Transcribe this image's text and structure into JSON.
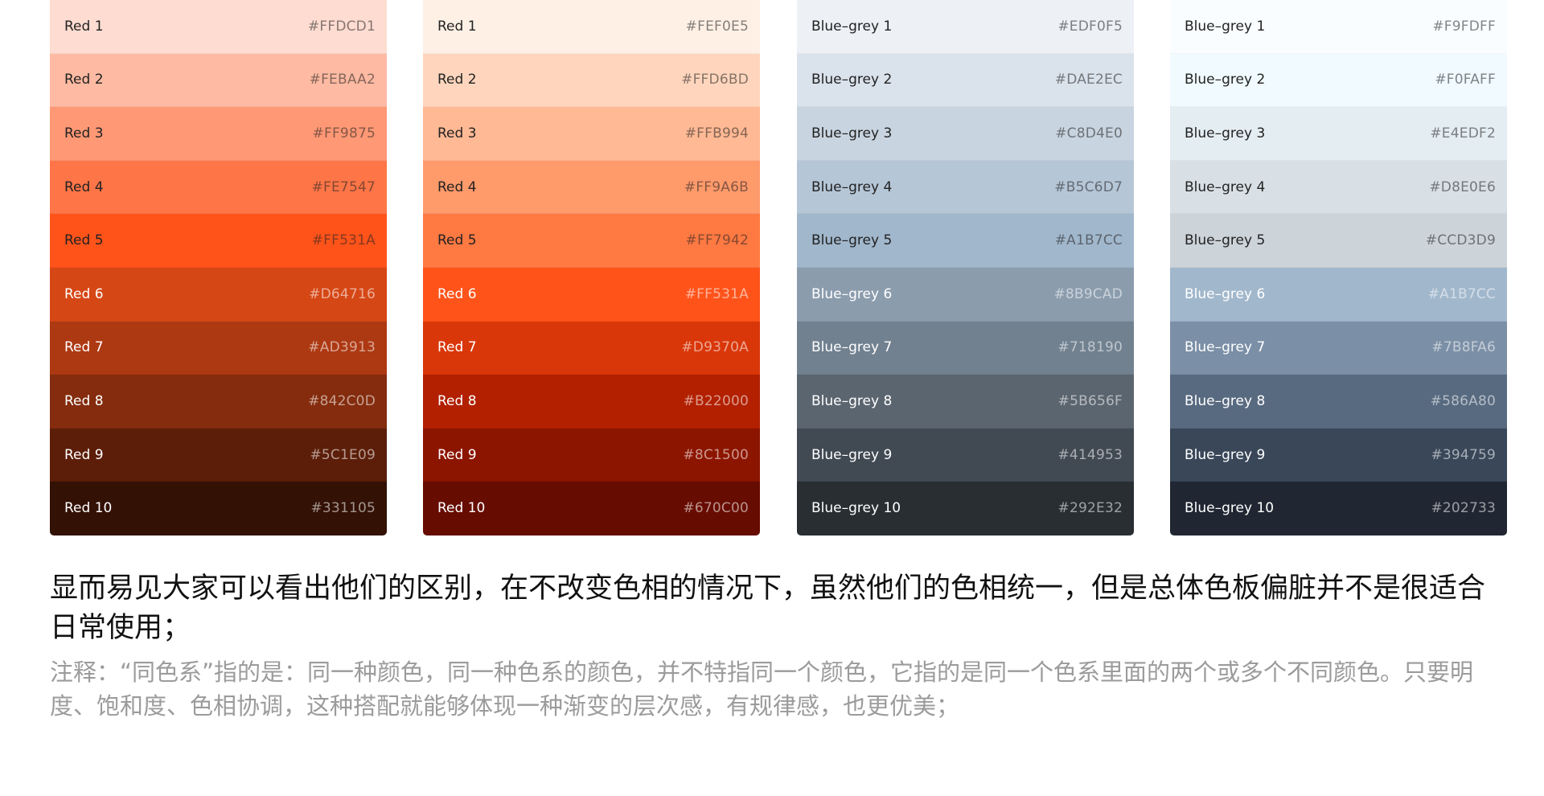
{
  "palettes": [
    {
      "swatches": [
        {
          "label": "Red 1",
          "hex": "#FFDCD1",
          "text": "#222222"
        },
        {
          "label": "Red 2",
          "hex": "#FEBAA2",
          "text": "#222222"
        },
        {
          "label": "Red 3",
          "hex": "#FF9875",
          "text": "#222222"
        },
        {
          "label": "Red 4",
          "hex": "#FE7547",
          "text": "#222222"
        },
        {
          "label": "Red 5",
          "hex": "#FF531A",
          "text": "#222222"
        },
        {
          "label": "Red 6",
          "hex": "#D64716",
          "text": "#ffffff"
        },
        {
          "label": "Red 7",
          "hex": "#AD3913",
          "text": "#ffffff"
        },
        {
          "label": "Red 8",
          "hex": "#842C0D",
          "text": "#ffffff"
        },
        {
          "label": "Red 9",
          "hex": "#5C1E09",
          "text": "#ffffff"
        },
        {
          "label": "Red 10",
          "hex": "#331105",
          "text": "#ffffff"
        }
      ]
    },
    {
      "swatches": [
        {
          "label": "Red 1",
          "hex": "#FEF0E5",
          "text": "#222222"
        },
        {
          "label": "Red 2",
          "hex": "#FFD6BD",
          "text": "#222222"
        },
        {
          "label": "Red 3",
          "hex": "#FFB994",
          "text": "#222222"
        },
        {
          "label": "Red 4",
          "hex": "#FF9A6B",
          "text": "#222222"
        },
        {
          "label": "Red 5",
          "hex": "#FF7942",
          "text": "#222222"
        },
        {
          "label": "Red 6",
          "hex": "#FF531A",
          "text": "#ffffff"
        },
        {
          "label": "Red 7",
          "hex": "#D9370A",
          "text": "#ffffff"
        },
        {
          "label": "Red 8",
          "hex": "#B22000",
          "text": "#ffffff"
        },
        {
          "label": "Red 9",
          "hex": "#8C1500",
          "text": "#ffffff"
        },
        {
          "label": "Red 10",
          "hex": "#670C00",
          "text": "#ffffff"
        }
      ]
    },
    {
      "swatches": [
        {
          "label": "Blue–grey 1",
          "hex": "#EDF0F5",
          "text": "#222222"
        },
        {
          "label": "Blue–grey 2",
          "hex": "#DAE2EC",
          "text": "#222222"
        },
        {
          "label": "Blue–grey 3",
          "hex": "#C8D4E0",
          "text": "#222222"
        },
        {
          "label": "Blue–grey 4",
          "hex": "#B5C6D7",
          "text": "#222222"
        },
        {
          "label": "Blue–grey 5",
          "hex": "#A1B7CC",
          "text": "#222222"
        },
        {
          "label": "Blue–grey 6",
          "hex": "#8B9CAD",
          "text": "#ffffff"
        },
        {
          "label": "Blue–grey 7",
          "hex": "#718190",
          "text": "#ffffff"
        },
        {
          "label": "Blue–grey 8",
          "hex": "#5B656F",
          "text": "#ffffff"
        },
        {
          "label": "Blue–grey 9",
          "hex": "#414953",
          "text": "#ffffff"
        },
        {
          "label": "Blue–grey 10",
          "hex": "#292E32",
          "text": "#ffffff"
        }
      ]
    },
    {
      "swatches": [
        {
          "label": "Blue–grey 1",
          "hex": "#F9FDFF",
          "text": "#222222"
        },
        {
          "label": "Blue–grey 2",
          "hex": "#F0FAFF",
          "text": "#222222"
        },
        {
          "label": "Blue–grey 3",
          "hex": "#E4EDF2",
          "text": "#222222"
        },
        {
          "label": "Blue–grey 4",
          "hex": "#D8E0E6",
          "text": "#222222"
        },
        {
          "label": "Blue–grey 5",
          "hex": "#CCD3D9",
          "text": "#222222"
        },
        {
          "label": "Blue–grey 6",
          "hex": "#A1B7CC",
          "text": "#ffffff"
        },
        {
          "label": "Blue–grey 7",
          "hex": "#7B8FA6",
          "text": "#ffffff"
        },
        {
          "label": "Blue–grey 8",
          "hex": "#586A80",
          "text": "#ffffff"
        },
        {
          "label": "Blue–grey 9",
          "hex": "#394759",
          "text": "#ffffff"
        },
        {
          "label": "Blue–grey 10",
          "hex": "#202733",
          "text": "#ffffff"
        }
      ]
    }
  ],
  "description": {
    "main": "显而易见大家可以看出他们的区别，在不改变色相的情况下，虽然他们的色相统一，但是总体色板偏脏并不是很适合日常使用；",
    "note": "注释：“同色系”指的是：同一种颜色，同一种色系的颜色，并不特指同一个颜色，它指的是同一个色系里面的两个或多个不同颜色。只要明度、饱和度、色相协调，这种搭配就能够体现一种渐变的层次感，有规律感，也更优美；"
  }
}
